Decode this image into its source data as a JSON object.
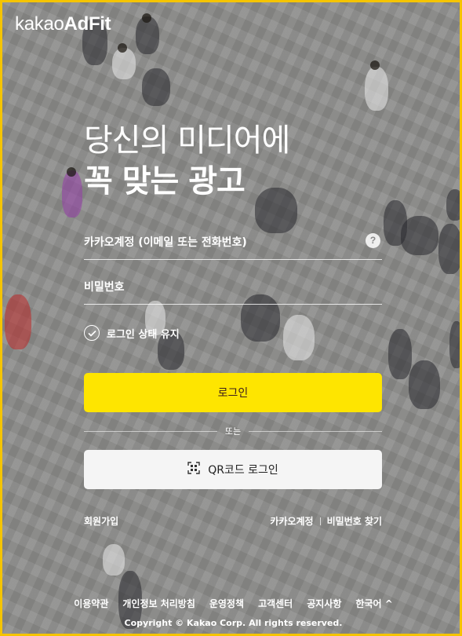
{
  "brand": {
    "prefix": "kakao",
    "suffix": "AdFit"
  },
  "headline": {
    "line1": "당신의 미디어에",
    "line2": "꼭 맞는 광고"
  },
  "form": {
    "account_placeholder": "카카오계정 (이메일 또는 전화번호)",
    "password_placeholder": "비밀번호",
    "help_symbol": "?",
    "keep_login_label": "로그인 상태 유지",
    "login_button": "로그인",
    "divider_text": "또는",
    "qr_button": "QR코드 로그인"
  },
  "links": {
    "signup": "회원가입",
    "find_account": "카카오계정",
    "find_password": "비밀번호 찾기"
  },
  "footer": {
    "items": [
      "이용약관",
      "개인정보 처리방침",
      "운영정책",
      "고객센터",
      "공지사항",
      "한국어 ^"
    ],
    "copyright_prefix": "Copyright ©",
    "copyright_company": "Kakao Corp.",
    "copyright_suffix": "All rights reserved."
  },
  "colors": {
    "accent": "#fee500",
    "frame": "#f5c400"
  }
}
